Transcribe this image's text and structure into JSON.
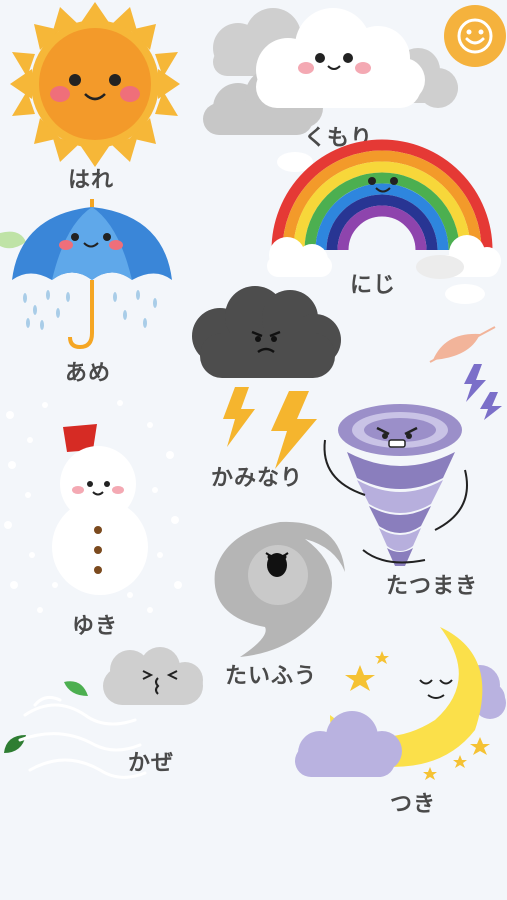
{
  "items": {
    "hare": {
      "label": "はれ"
    },
    "kumori": {
      "label": "くもり"
    },
    "ame": {
      "label": "あめ"
    },
    "niji": {
      "label": "にじ"
    },
    "kaminari": {
      "label": "かみなり"
    },
    "tatsumaki": {
      "label": "たつまき"
    },
    "yuki": {
      "label": "ゆき"
    },
    "taifuu": {
      "label": "たいふう"
    },
    "kaze": {
      "label": "かぜ"
    },
    "tsuki": {
      "label": "つき"
    }
  },
  "colors": {
    "background": "#f3f6fa",
    "sun": "#f5a623",
    "umbrella": "#3a86d8",
    "storm_cloud": "#4a4a4a",
    "lightning": "#f5b52e",
    "tornado": "#9b8fc9",
    "moon": "#fbe04a",
    "label_text": "#4a4a4a",
    "smiley_button": "#f5b23d"
  },
  "icons": {
    "top_right_button": "smiley-face-icon"
  }
}
